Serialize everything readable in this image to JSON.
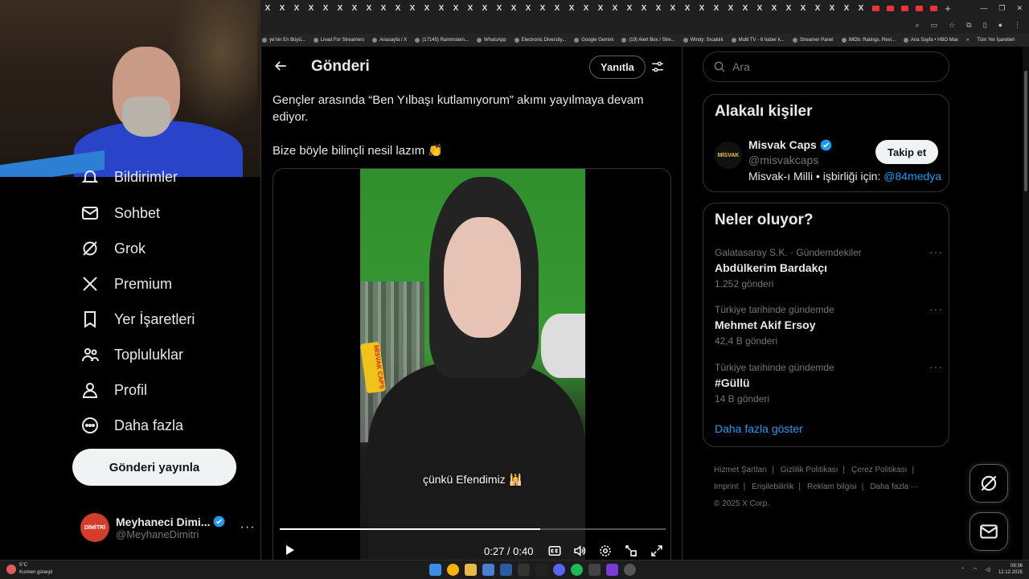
{
  "browser": {
    "tab_close_glyph": "X",
    "new_tab_glyph": "+",
    "bookmarks": [
      "ye'nin En Büyü...",
      "Livad For Streamers",
      "Anasayfa / X",
      "(17145) Rammstein...",
      "WhatsApp",
      "Electronic Diversity...",
      "Google Gemini",
      "(19) Alert Box / Stre...",
      "Windy: Sıcaklık",
      "Multi TV - 6 haber k...",
      "Streamer Panel",
      "IMDb: Ratings, Revi...",
      "Ana Sayfa • HBO Max"
    ],
    "bookmarks_more": "»",
    "all_bookmarks": "Tüm Yer İşaretleri"
  },
  "nav": {
    "partial_item": "Bildirimler",
    "items": [
      {
        "label": "Sohbet",
        "icon": "mail-icon"
      },
      {
        "label": "Grok",
        "icon": "grok-icon"
      },
      {
        "label": "Premium",
        "icon": "x-logo-icon"
      },
      {
        "label": "Yer İşaretleri",
        "icon": "bookmark-icon"
      },
      {
        "label": "Topluluklar",
        "icon": "communities-icon"
      },
      {
        "label": "Profil",
        "icon": "person-icon"
      },
      {
        "label": "Daha fazla",
        "icon": "more-circle-icon"
      }
    ],
    "post_button": "Gönderi yayınla",
    "profile": {
      "name": "Meyhaneci Dimi...",
      "handle": "@MeyhaneDimitri",
      "more": "···",
      "avatar_text": "DİMİTRİ"
    }
  },
  "main": {
    "title": "Gönderi",
    "reply_button": "Yanıtla",
    "tweet_paragraphs": [
      "Gençler arasında “Ben Yılbaşı kutlamıyorum” akımı yayılmaya devam ediyor.",
      "Bize böyle bilinçli nesil lazım 👏"
    ],
    "video": {
      "caption": "çünkü Efendimiz 🕌",
      "watermark": "MİSVAK CAPS",
      "time": "0:27 / 0:40",
      "progress": 0.675
    }
  },
  "sidebar": {
    "search_placeholder": "Ara",
    "related": {
      "title": "Alakalı kişiler",
      "name": "Misvak Caps",
      "handle": "@misvakcaps",
      "bio_text": "Misvak-ı Milli • işbirliği için: ",
      "bio_link": "@84medya",
      "follow_button": "Takip et",
      "avatar_text": "MİSVAK"
    },
    "trending": {
      "title": "Neler oluyor?",
      "items": [
        {
          "meta": "Galatasaray S.K. · Gündemdekiler",
          "topic": "Abdülkerim Bardakçı",
          "count": "1.252 gönderi"
        },
        {
          "meta": "Türkiye tarihinde gündemde",
          "topic": "Mehmet Akif Ersoy",
          "count": "42,4 B gönderi"
        },
        {
          "meta": "Türkiye tarihinde gündemde",
          "topic": "#Güllü",
          "count": "14 B gönderi"
        }
      ],
      "more_glyph": "···",
      "show_more": "Daha fazla göster"
    },
    "footer": {
      "links": [
        "Hizmet Şartları",
        "Gizlilik Politikası",
        "Çerez Politikası",
        "Imprint",
        "Erişilebilirlik",
        "Reklam bilgisi",
        "Daha fazla ···"
      ],
      "separator": "|",
      "copyright": "© 2025 X Corp."
    }
  },
  "taskbar": {
    "temperature": "5°C",
    "weather": "Kısmen güneşli",
    "time": "09:36",
    "date": "12.12.2025"
  },
  "colors": {
    "accent": "#1d9bf0",
    "verified": "#1d9bf0",
    "text": "#e7e9ea",
    "muted": "#71767b",
    "border": "#2f3336"
  }
}
